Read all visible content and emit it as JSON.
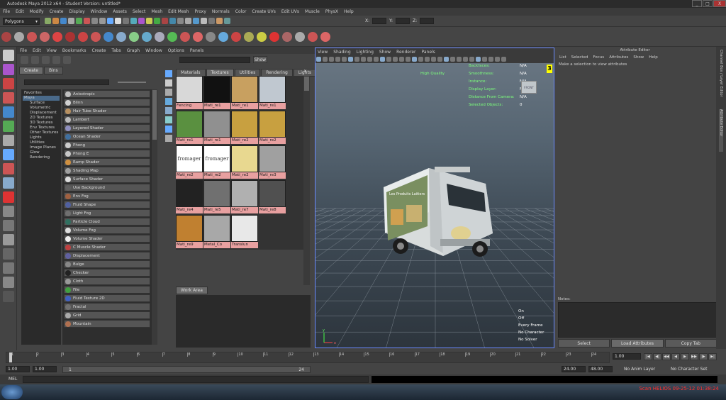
{
  "window": {
    "title": "Autodesk Maya 2012 x64 - Student Version: untitled*",
    "min": "_",
    "max": "□",
    "close": "X"
  },
  "menus": [
    "File",
    "Edit",
    "Modify",
    "Create",
    "Display",
    "Window",
    "Assets",
    "Select",
    "Mesh",
    "Edit Mesh",
    "Proxy",
    "Normals",
    "Color",
    "Create UVs",
    "Edit UVs",
    "Muscle",
    "PhysX",
    "Help"
  ],
  "status": {
    "mode": "Polygons",
    "x_label": "X:",
    "y_label": "Y:",
    "z_label": "Z:"
  },
  "hypershade": {
    "menus": [
      "File",
      "Edit",
      "View",
      "Bookmarks",
      "Create",
      "Tabs",
      "Graph",
      "Window",
      "Options",
      "Panels"
    ],
    "show_button": "Show",
    "left_tabs": [
      "Create",
      "Bins"
    ],
    "tree": [
      "Favorites",
      "Maya",
      "Surface",
      "Volumetric",
      "Displacement",
      "2D Textures",
      "3D Textures",
      "Env Textures",
      "Other Textures",
      "Lights",
      "Utilities",
      "Image Planes",
      "Glow",
      "Rendering"
    ],
    "nodes": [
      {
        "name": "Anisotropic",
        "color": "#c0c0c0"
      },
      {
        "name": "Blinn",
        "color": "#d0d0d0"
      },
      {
        "name": "Hair Tube Shader",
        "color": "#b89060"
      },
      {
        "name": "Lambert",
        "color": "#bbbbbb"
      },
      {
        "name": "Layered Shader",
        "color": "#9090c0"
      },
      {
        "name": "Ocean Shader",
        "color": "#4070a0"
      },
      {
        "name": "Phong",
        "color": "#cccccc"
      },
      {
        "name": "Phong E",
        "color": "#c8c8c8"
      },
      {
        "name": "Ramp Shader",
        "color": "#d09040"
      },
      {
        "name": "Shading Map",
        "color": "#a0a0a0"
      },
      {
        "name": "Surface Shader",
        "color": "#dddddd"
      },
      {
        "name": "Use Background",
        "color": "#606060"
      },
      {
        "name": "Env Fog",
        "color": "#a06040"
      },
      {
        "name": "Fluid Shape",
        "color": "#5060a0"
      },
      {
        "name": "Light Fog",
        "color": "#707070"
      },
      {
        "name": "Particle Cloud",
        "color": "#307060"
      },
      {
        "name": "Volume Fog",
        "color": "#dddddd"
      },
      {
        "name": "Volume Shader",
        "color": "#eeeeee"
      },
      {
        "name": "C Muscle Shader",
        "color": "#c04040"
      },
      {
        "name": "Displacement",
        "color": "#6060a0"
      },
      {
        "name": "Bulge",
        "color": "#888888"
      },
      {
        "name": "Checker",
        "color": "#222222"
      },
      {
        "name": "Cloth",
        "color": "#999999"
      },
      {
        "name": "File",
        "color": "#40a040"
      },
      {
        "name": "Fluid Texture 2D",
        "color": "#4060c0"
      },
      {
        "name": "Fractal",
        "color": "#707070"
      },
      {
        "name": "Grid",
        "color": "#aaaaaa"
      },
      {
        "name": "Mountain",
        "color": "#b07050"
      }
    ],
    "right_tabs": [
      "Materials",
      "Textures",
      "Utilities",
      "Rendering",
      "Lights"
    ],
    "swatches": [
      {
        "label": "Fencing",
        "color": "#d8d8d8"
      },
      {
        "label": "Mati_re1",
        "color": "#111111"
      },
      {
        "label": "Mati_re1",
        "color": "#c8a060"
      },
      {
        "label": "Mati_re1",
        "color": "#c0c8d0"
      },
      {
        "label": "Mati_re1",
        "color": "#5a9040"
      },
      {
        "label": "Mati_re1",
        "color": "#909090"
      },
      {
        "label": "Mati_re2",
        "color": "#c8a040"
      },
      {
        "label": "Mati_re2",
        "color": "#c8a040"
      },
      {
        "label": "Mati_re2",
        "color": "#ffffff"
      },
      {
        "label": "Mati_re2",
        "color": "#ffffff"
      },
      {
        "label": "Mati_re2",
        "color": "#e8d890"
      },
      {
        "label": "Mati_re3",
        "color": "#a0a0a0"
      },
      {
        "label": "Mati_re4",
        "color": "#222222"
      },
      {
        "label": "Mati_re5",
        "color": "#707070"
      },
      {
        "label": "Mati_re7",
        "color": "#b0b0b0"
      },
      {
        "label": "Mati_re8",
        "color": "#505050"
      },
      {
        "label": "Mati_re9",
        "color": "#c08030"
      },
      {
        "label": "Metal_Co",
        "color": "#a8a8a8"
      },
      {
        "label": "Translun",
        "color": "#e8e8e8"
      }
    ],
    "swatch_text": "fromager",
    "work_area": "Work Area"
  },
  "viewport": {
    "menus": [
      "View",
      "Shading",
      "Lighting",
      "Show",
      "Renderer",
      "Panels"
    ],
    "quality": "High Quality",
    "hud": [
      {
        "label": "Backfaces:",
        "value": "N/A"
      },
      {
        "label": "Smoothness:",
        "value": "N/A"
      },
      {
        "label": "Instance:",
        "value": "N/A"
      },
      {
        "label": "Display Layer:",
        "value": "N/A"
      },
      {
        "label": "Distance From Camera:",
        "value": "N/A"
      },
      {
        "label": "Selected Objects:",
        "value": "0"
      }
    ],
    "hud_bottom": [
      "On",
      "Off",
      "Every Frame",
      "No Character",
      "No Solver"
    ],
    "view_cube": "FRONT",
    "truck_text": "Les Produits Laitiers",
    "axis_x": "x",
    "axis_y": "y"
  },
  "attribute_editor": {
    "title": "Attribute Editor",
    "menus": [
      "List",
      "Selected",
      "Focus",
      "Attributes",
      "Show",
      "Help"
    ],
    "message": "Make a selection to view attributes",
    "notes": "Notes:",
    "buttons": [
      "Select",
      "Load Attributes",
      "Copy Tab"
    ],
    "side_tabs": [
      "Channel Box / Layer Editor",
      "Attribute Editor"
    ]
  },
  "timeline": {
    "ticks": [
      "1",
      "2",
      "3",
      "4",
      "5",
      "6",
      "7",
      "8",
      "9",
      "10",
      "11",
      "12",
      "13",
      "14",
      "15",
      "16",
      "17",
      "18",
      "19",
      "20",
      "21",
      "22",
      "23",
      "24"
    ],
    "current": "1.00",
    "range_start": "1.00",
    "range_start2": "1.00",
    "range_in": "1",
    "range_out": "24",
    "end1": "24.00",
    "end2": "48.00",
    "anim_layer": "No Anim Layer",
    "char_set": "No Character Set"
  },
  "command": {
    "label": "MEL"
  },
  "watermark": "Scan HELIOS 09-25-12 01:38:24",
  "colors": {
    "viewport_border": "#6a8aff",
    "hud_label": "#7cff7c",
    "swatch_label_bg": "#e8a0a0",
    "watermark": "#ff3030"
  }
}
